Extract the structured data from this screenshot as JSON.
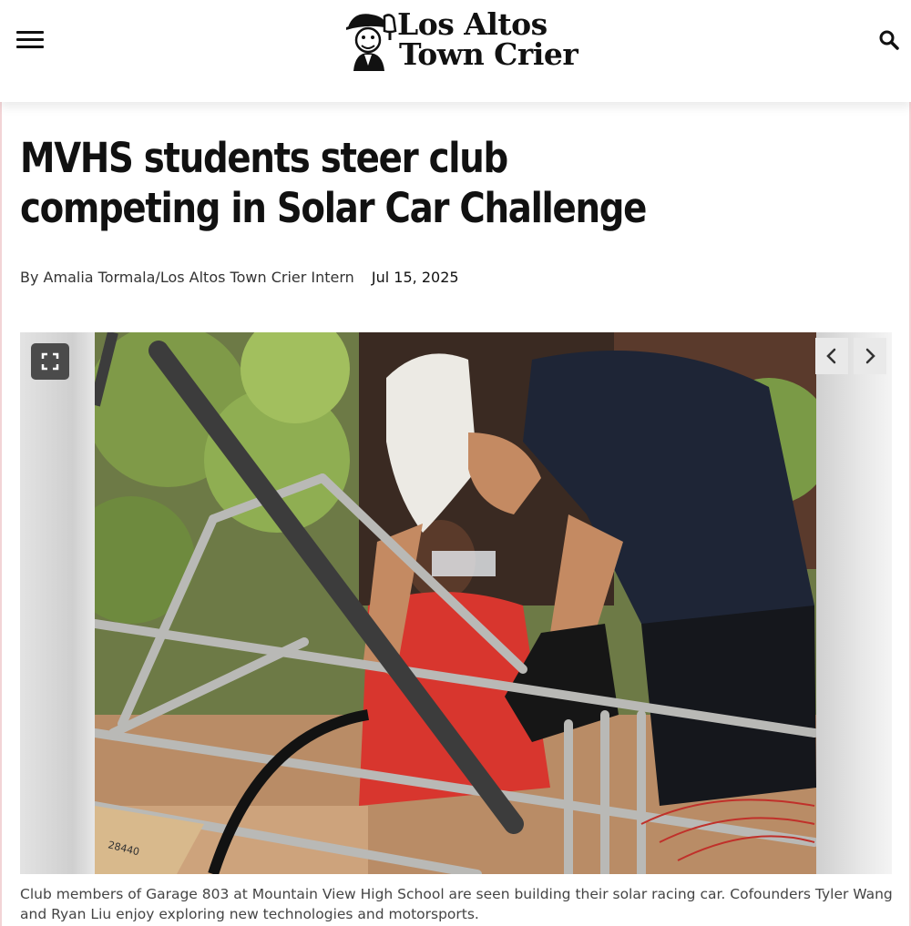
{
  "site": {
    "name_line1": "Los Altos",
    "name_line2": "Town Crier"
  },
  "header": {
    "menu_icon": "hamburger-menu-icon",
    "search_icon": "search-icon"
  },
  "article": {
    "headline": "MVHS students steer club competing in Solar Car Challenge",
    "byline": "By Amalia Tormala/Los Altos Town Crier Intern",
    "date": "Jul 15, 2025"
  },
  "gallery": {
    "expand_icon": "expand-icon",
    "prev_icon": "chevron-left-icon",
    "next_icon": "chevron-right-icon",
    "caption": "Club members of Garage 803 at Mountain View High School are seen building their solar racing car. Cofounders Tyler Wang and Ryan Liu enjoy exploring new technologies and motorsports.",
    "box_label": "28440"
  },
  "colors": {
    "text": "#111111",
    "caption": "#444444",
    "frame": "#f2d4d6"
  }
}
